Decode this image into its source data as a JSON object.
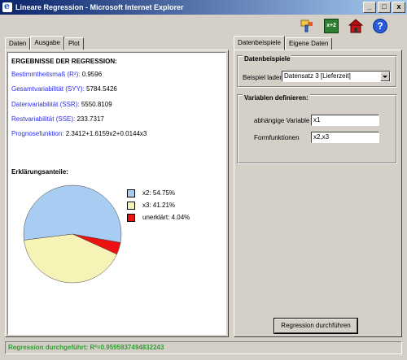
{
  "window": {
    "title": "Lineare Regression - Microsoft Internet Explorer",
    "controls": [
      "_",
      "□",
      "x"
    ]
  },
  "toolbar": {
    "icons": [
      "paintbrush-icon",
      "calculator-icon",
      "house-icon",
      "help-icon"
    ],
    "calc_label": "x+2",
    "help_label": "?"
  },
  "left_tabs": [
    {
      "label": "Daten",
      "active": false
    },
    {
      "label": "Ausgabe",
      "active": true
    },
    {
      "label": "Plot",
      "active": false
    }
  ],
  "results": {
    "heading": "ERGEBNISSE DER REGRESSION:",
    "metrics": [
      {
        "label": "Bestimmtheitsmaß (R²):",
        "value": "0.9596"
      },
      {
        "label": "Gesamtvariabilität (SYY):",
        "value": "5784.5426"
      },
      {
        "label": "Datenvariabilität (SSR):",
        "value": "5550.8109"
      },
      {
        "label": "Restvariabilität (SSE):",
        "value": "233.7317"
      },
      {
        "label": "Prognosefunktion:",
        "value": "2.3412+1.6159x2+0.0144x3"
      }
    ]
  },
  "explain": {
    "heading": "Erklärungsanteile:"
  },
  "chart_data": {
    "type": "pie",
    "values": [
      54.75,
      41.21,
      4.04
    ],
    "labels": [
      "x2: 54.75%",
      "x3: 41.21%",
      "unerklärt: 4.04%"
    ],
    "colors": [
      "#a9ccf2",
      "#f7f3b6",
      "#ee1111"
    ]
  },
  "right_tabs": [
    {
      "label": "Datenbeispiele",
      "active": true
    },
    {
      "label": "Eigene Daten",
      "active": false
    }
  ],
  "datenbeispiele": {
    "group_title": "Datenbeispiele",
    "label": "Beispiel laden",
    "selected": "Datensatz 3 [Lieferzeit]"
  },
  "variablen": {
    "group_title": "Variablen definieren:",
    "dependent_label": "abhängige Variable",
    "dependent_value": "x1",
    "form_label": "Formfunktionen",
    "form_value": "x2,x3"
  },
  "actions": {
    "run_label": "Regression durchführen"
  },
  "status": {
    "text": "Regression durchgeführt: R²=0.9595937494832243",
    "color": "#2e9e2e"
  }
}
